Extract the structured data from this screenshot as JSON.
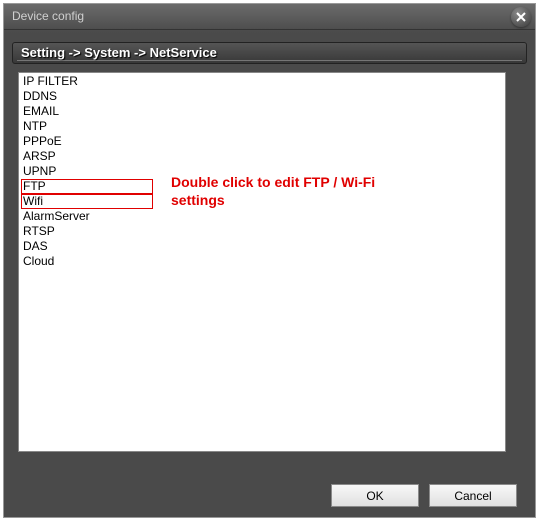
{
  "window": {
    "title": "Device config"
  },
  "breadcrumb": {
    "text": "Setting -> System -> NetService"
  },
  "services": {
    "items": [
      "IP FILTER",
      "DDNS",
      "EMAIL",
      "NTP",
      "PPPoE",
      "ARSP",
      "UPNP",
      "FTP",
      "Wifi",
      "AlarmServer",
      "RTSP",
      "DAS",
      "Cloud"
    ]
  },
  "annotation": {
    "text": "Double click to edit FTP / Wi-Fi settings",
    "highlighted": [
      "FTP",
      "Wifi"
    ]
  },
  "buttons": {
    "ok": "OK",
    "cancel": "Cancel"
  }
}
